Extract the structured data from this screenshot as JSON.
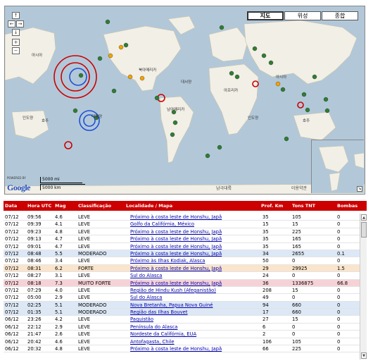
{
  "map": {
    "types": [
      "지도",
      "위성",
      "종합"
    ],
    "active_type": "지도",
    "controls": [
      "↑",
      "←",
      "→",
      "↓",
      "+",
      "−"
    ],
    "labels": {
      "asia_w": "아시아",
      "na": "북아메리카",
      "atlantic": "대서양",
      "africa": "아프리카",
      "asia_e": "아시아",
      "pacific": "대평양",
      "india_w": "인도양",
      "india_e": "인도양",
      "sa": "남아메리카",
      "oceania_w": "호주",
      "oceania_e": "호주",
      "antarctica": "남극대륙"
    },
    "powered_by": "POWERED BY",
    "google": "Google",
    "scale_top": "5000 mi",
    "scale_bottom": "5000 km",
    "copyright": "이용약관",
    "colors": {
      "sea": "#b2c8d9",
      "land": "#f2efe6",
      "quake_leve": "#2e7d32",
      "quake_strong": "#cc0000",
      "quake_blue": "#1f4fd6",
      "quake_orange": "#f4a300"
    }
  },
  "table": {
    "headers": {
      "date": "Data",
      "time": "Hora UTC",
      "mag": "Mag",
      "class": "Classificação",
      "loc": "Localidade / Mapa",
      "depth": "Prof. Km",
      "tnt": "Tons TNT",
      "bombs": "Bombas"
    },
    "rows": [
      {
        "date": "07/12",
        "time": "09:56",
        "mag": "4.6",
        "class": "LEVE",
        "loc": "Próximo à costa leste de Honshu, Japã",
        "depth": "35",
        "tnt": "105",
        "bombs": "0",
        "kind": "leve"
      },
      {
        "date": "07/12",
        "time": "09:39",
        "mag": "4.1",
        "class": "LEVE",
        "loc": "Golfo da Califórnia, México",
        "depth": "15",
        "tnt": "15",
        "bombs": "0",
        "kind": "leve"
      },
      {
        "date": "07/12",
        "time": "09:23",
        "mag": "4.8",
        "class": "LEVE",
        "loc": "Próximo à costa leste de Honshu, Japã",
        "depth": "35",
        "tnt": "225",
        "bombs": "0",
        "kind": "leve"
      },
      {
        "date": "07/12",
        "time": "09:13",
        "mag": "4.7",
        "class": "LEVE",
        "loc": "Próximo à costa leste de Honshu, Japã",
        "depth": "35",
        "tnt": "165",
        "bombs": "0",
        "kind": "leve"
      },
      {
        "date": "07/12",
        "time": "09:01",
        "mag": "4.7",
        "class": "LEVE",
        "loc": "Próximo à costa leste de Honshu, Japã",
        "depth": "35",
        "tnt": "165",
        "bombs": "0",
        "kind": "leve"
      },
      {
        "date": "07/12",
        "time": "08:48",
        "mag": "5.5",
        "class": "MODERADO",
        "loc": "Próximo à costa leste de Honshu, Japã",
        "depth": "34",
        "tnt": "2655",
        "bombs": "0.1",
        "kind": "moderado"
      },
      {
        "date": "07/12",
        "time": "08:46",
        "mag": "3.4",
        "class": "LEVE",
        "loc": "Próximo às Ilhas Kodiak, Alasca",
        "depth": "50",
        "tnt": "0",
        "bombs": "0",
        "kind": "leve"
      },
      {
        "date": "07/12",
        "time": "08:31",
        "mag": "6.2",
        "class": "FORTE",
        "loc": "Próximo à costa leste de Honshu, Japã",
        "depth": "29",
        "tnt": "29925",
        "bombs": "1.5",
        "kind": "forte"
      },
      {
        "date": "07/12",
        "time": "08:27",
        "mag": "3.1",
        "class": "LEVE",
        "loc": "Sul do Alasca",
        "depth": "24",
        "tnt": "0",
        "bombs": "0",
        "kind": "leve"
      },
      {
        "date": "07/12",
        "time": "08:18",
        "mag": "7.3",
        "class": "MUITO FORTE",
        "loc": "Próximo à costa leste de Honshu, Japã",
        "depth": "36",
        "tnt": "1336875",
        "bombs": "66.8",
        "kind": "muitoforte"
      },
      {
        "date": "07/12",
        "time": "07:29",
        "mag": "4.0",
        "class": "LEVE",
        "loc": "Região de Hindu Kush (Afeganistão)",
        "depth": "208",
        "tnt": "15",
        "bombs": "0",
        "kind": "leve"
      },
      {
        "date": "07/12",
        "time": "05:00",
        "mag": "2.9",
        "class": "LEVE",
        "loc": "Sul do Alasca",
        "depth": "49",
        "tnt": "0",
        "bombs": "0",
        "kind": "leve"
      },
      {
        "date": "07/12",
        "time": "02:25",
        "mag": "5.1",
        "class": "MODERADO",
        "loc": "Nova Bretanha, Papua Nova Guiné",
        "depth": "94",
        "tnt": "660",
        "bombs": "0",
        "kind": "moderado"
      },
      {
        "date": "07/12",
        "time": "01:35",
        "mag": "5.1",
        "class": "MODERADO",
        "loc": "Região das Ilhas Bouvet",
        "depth": "17",
        "tnt": "660",
        "bombs": "0",
        "kind": "moderado"
      },
      {
        "date": "06/12",
        "time": "23:26",
        "mag": "4.2",
        "class": "LEVE",
        "loc": "Paquistão",
        "depth": "27",
        "tnt": "15",
        "bombs": "0",
        "kind": "leve"
      },
      {
        "date": "06/12",
        "time": "22:12",
        "mag": "2.9",
        "class": "LEVE",
        "loc": "Península do Alasca",
        "depth": "6",
        "tnt": "0",
        "bombs": "0",
        "kind": "leve"
      },
      {
        "date": "06/12",
        "time": "21:47",
        "mag": "2.6",
        "class": "LEVE",
        "loc": "Nordeste da Califórnia, EUA",
        "depth": "2",
        "tnt": "0",
        "bombs": "0",
        "kind": "leve"
      },
      {
        "date": "06/12",
        "time": "20:42",
        "mag": "4.6",
        "class": "LEVE",
        "loc": "Antofagasta, Chile",
        "depth": "106",
        "tnt": "105",
        "bombs": "0",
        "kind": "leve"
      },
      {
        "date": "06/12",
        "time": "20:32",
        "mag": "4.8",
        "class": "LEVE",
        "loc": "Próximo à costa leste de Honshu, Japã",
        "depth": "66",
        "tnt": "225",
        "bombs": "0",
        "kind": "leve"
      }
    ]
  }
}
